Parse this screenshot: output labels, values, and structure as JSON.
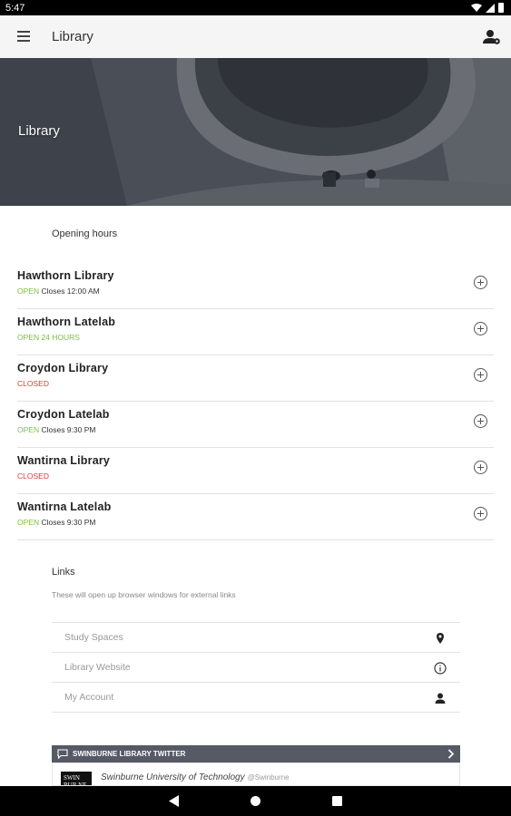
{
  "status_bar": {
    "time": "5:47"
  },
  "app_bar": {
    "title": "Library"
  },
  "hero": {
    "title": "Library"
  },
  "opening_hours": {
    "heading": "Opening hours",
    "libraries": [
      {
        "name": "Hawthorn Library",
        "state": "OPEN",
        "detail": "Closes 12:00 AM"
      },
      {
        "name": "Hawthorn Latelab",
        "state": "OPEN 24 HOURS",
        "detail": ""
      },
      {
        "name": "Croydon Library",
        "state": "CLOSED",
        "detail": ""
      },
      {
        "name": "Croydon Latelab",
        "state": "OPEN",
        "detail": "Closes 9:30 PM"
      },
      {
        "name": "Wantirna Library",
        "state": "CLOSED",
        "detail": ""
      },
      {
        "name": "Wantirna Latelab",
        "state": "OPEN",
        "detail": "Closes 9:30 PM"
      }
    ]
  },
  "links": {
    "heading": "Links",
    "subtitle": "These will open up browser windows for external links",
    "items": [
      {
        "label": "Study Spaces",
        "icon": "location-pin-icon"
      },
      {
        "label": "Library Website",
        "icon": "info-icon"
      },
      {
        "label": "My Account",
        "icon": "person-icon"
      }
    ]
  },
  "twitter": {
    "header": "SWINBURNE LIBRARY TWITTER",
    "avatar_text": "SWIN BUR NE",
    "author": "Swinburne University of Technology",
    "handle": "@Swinburne"
  },
  "colors": {
    "open": "#7cbf3a",
    "closed": "#e53935",
    "twitter_bar": "#555a65"
  }
}
